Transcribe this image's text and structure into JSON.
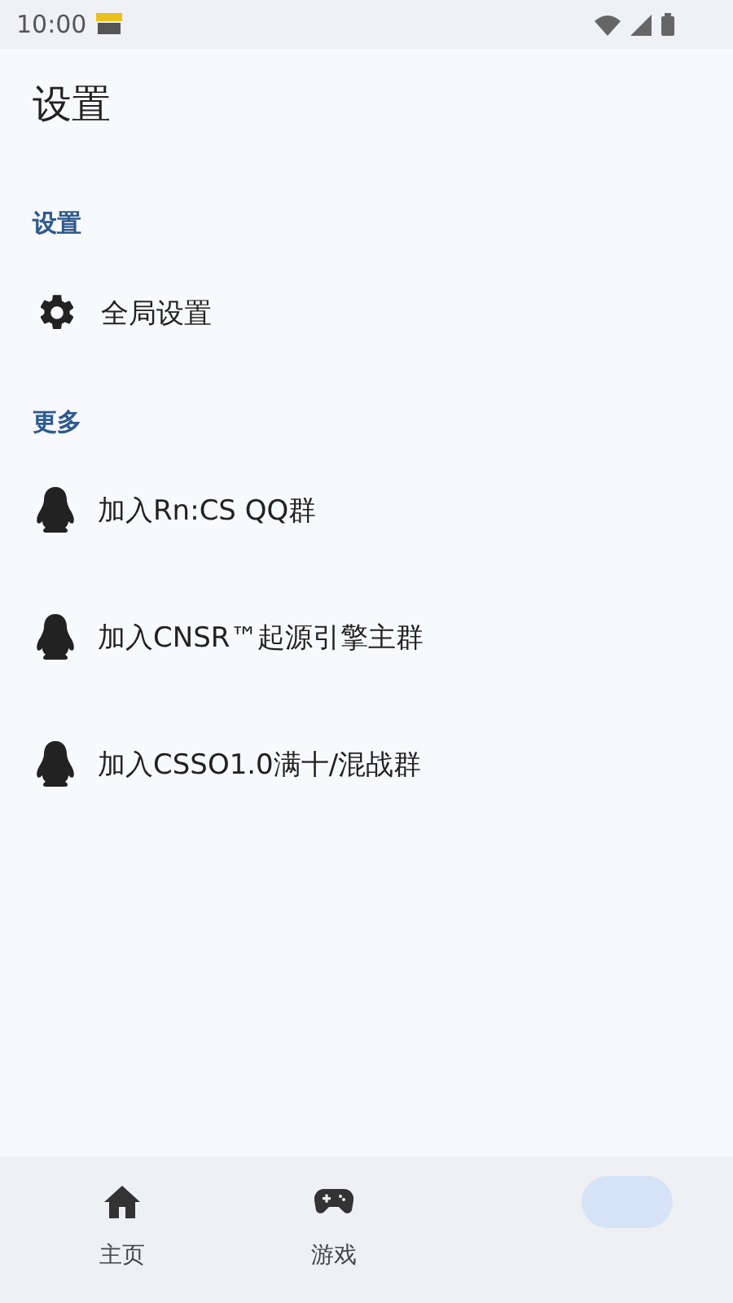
{
  "status_bar": {
    "time": "10:00"
  },
  "title": "设置",
  "sections": [
    {
      "header": "设置",
      "items": [
        {
          "kind": "setting",
          "label": "全局设置"
        }
      ]
    },
    {
      "header": "更多",
      "items": [
        {
          "kind": "qq",
          "label": "加入Rn:CS QQ群"
        },
        {
          "kind": "qq",
          "label": "加入CNSR™起源引擎主群"
        },
        {
          "kind": "qq",
          "label": "加入CSSO1.0满十/混战群"
        }
      ]
    }
  ],
  "bottom_nav": [
    {
      "label": "主页",
      "selected": false
    },
    {
      "label": "游戏",
      "selected": false
    },
    {
      "selected": true
    }
  ]
}
